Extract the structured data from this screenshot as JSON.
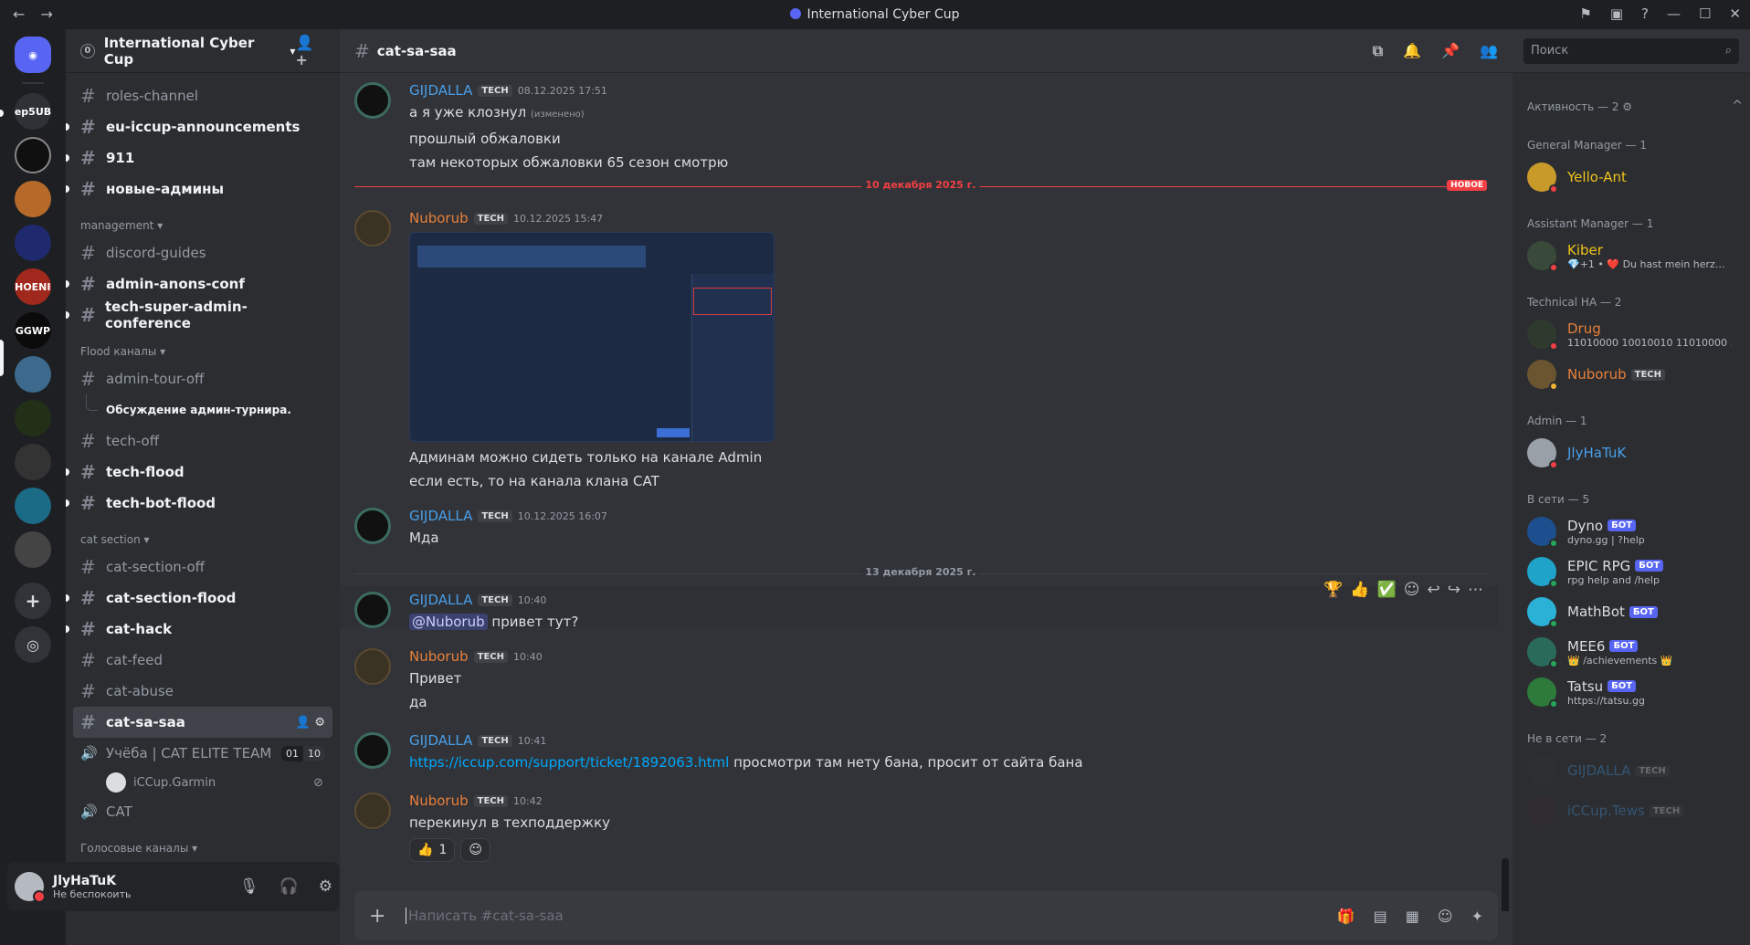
{
  "titlebar": {
    "back": "←",
    "forward": "→",
    "title": "International Cyber Cup"
  },
  "guilds": [
    "ep5UB",
    "",
    "",
    "",
    "",
    "PHOENIX",
    "GGWP",
    "",
    "",
    "",
    "",
    "",
    ""
  ],
  "server": {
    "badge": "0",
    "name": "International Cyber Cup"
  },
  "channels": {
    "top": [
      {
        "name": "roles-channel",
        "unread": false
      },
      {
        "name": "eu-iccup-announcements",
        "unread": true
      },
      {
        "name": "911",
        "unread": true
      },
      {
        "name": "новые-админы",
        "unread": true
      }
    ],
    "management_label": "management",
    "management": [
      {
        "name": "discord-guides",
        "unread": false
      },
      {
        "name": "admin-anons-conf",
        "unread": true
      },
      {
        "name": "tech-super-admin-conference",
        "unread": true
      }
    ],
    "flood_label": "Flood каналы",
    "flood": [
      {
        "name": "admin-tour-off",
        "unread": false
      }
    ],
    "thread": "Обсуждение админ-турнира.",
    "flood2": [
      {
        "name": "tech-off",
        "unread": false
      },
      {
        "name": "tech-flood",
        "unread": true
      },
      {
        "name": "tech-bot-flood",
        "unread": true
      }
    ],
    "cat_label": "cat section",
    "cat": [
      {
        "name": "cat-section-off",
        "unread": false
      },
      {
        "name": "cat-section-flood",
        "unread": true
      },
      {
        "name": "cat-hack",
        "unread": true
      },
      {
        "name": "cat-feed",
        "unread": false
      },
      {
        "name": "cat-abuse",
        "unread": false
      }
    ],
    "active": "cat-sa-saa",
    "voice1": {
      "name": "Учёба | CAT ELITE TEAM",
      "count_a": "01",
      "count_b": "10"
    },
    "voice_user": "iCCup.Garmin",
    "voice2": {
      "name": "CAT"
    },
    "voice_label": "Голосовые каналы"
  },
  "user": {
    "name": "JlyHaTuK",
    "status": "Не беспокоить"
  },
  "header": {
    "channel": "cat-sa-saa"
  },
  "messages": {
    "m1": {
      "author": "GIJDALLA",
      "tag": "TECH",
      "time": "08.12.2025 17:51",
      "lines": [
        "а я уже клознул",
        "прошлый обжаловки",
        "там некоторых обжаловки 65 сезон смотрю"
      ],
      "edited": "(изменено)"
    },
    "divider1": {
      "label": "10 декабря 2025 г.",
      "new": "НОВОЕ"
    },
    "m2": {
      "author": "Nuborub",
      "tag": "TECH",
      "time": "10.12.2025 15:47",
      "lines": [
        "Админам можно сидеть только на канале Admin",
        "если есть, то на канала клана CAT"
      ]
    },
    "m3": {
      "author": "GIJDALLA",
      "tag": "TECH",
      "time": "10.12.2025 16:07",
      "lines": [
        "Мда"
      ]
    },
    "divider2": {
      "label": "13 декабря 2025 г."
    },
    "m4": {
      "author": "GIJDALLA",
      "tag": "TECH",
      "time": "10:40",
      "mention": "@Nuborub",
      "text": "привет тут?"
    },
    "m5": {
      "author": "Nuborub",
      "tag": "TECH",
      "time": "10:40",
      "lines": [
        "Привет",
        "да"
      ]
    },
    "m6": {
      "author": "GIJDALLA",
      "tag": "TECH",
      "time": "10:41",
      "link": "https://iccup.com/support/ticket/1892063.html",
      "text": "просмотри там нету бана, просит от сайта бана"
    },
    "m7": {
      "author": "Nuborub",
      "tag": "TECH",
      "time": "10:42",
      "lines": [
        "перекинул в техподдержку"
      ],
      "reaction": {
        "emoji": "👍",
        "count": "1"
      }
    }
  },
  "composer": {
    "placeholder": "Написать #cat-sa-saa"
  },
  "search": {
    "placeholder": "Поиск"
  },
  "members": {
    "activity": "Активность — 2 ⚙",
    "groups": [
      {
        "label": "General Manager — 1",
        "items": [
          {
            "name": "Yello-Ant",
            "color": "#f0c31a",
            "status": "#f23f43"
          }
        ]
      },
      {
        "label": "Assistant Manager — 1",
        "items": [
          {
            "name": "Kiber",
            "color": "#f0c31a",
            "sub": "💎+1 • ❤️ Du hast mein herz...",
            "status": "#f23f43"
          }
        ]
      },
      {
        "label": "Technical HA — 2",
        "items": [
          {
            "name": "Drug",
            "color": "#e8803a",
            "sub": "11010000 10010010 11010000 ...",
            "status": "#f23f43"
          },
          {
            "name": "Nuborub",
            "color": "#e8803a",
            "tag": "TECH",
            "status": "#f0b232"
          }
        ]
      },
      {
        "label": "Admin — 1",
        "items": [
          {
            "name": "JlyHaTuK",
            "color": "#4a9fe8",
            "status": "#f23f43"
          }
        ]
      },
      {
        "label": "В сети — 5",
        "items": [
          {
            "name": "Dyno",
            "color": "#dbdee1",
            "bot": "БОТ",
            "sub": "dyno.gg | ?help",
            "status": "#23a55a"
          },
          {
            "name": "EPIC RPG",
            "color": "#dbdee1",
            "bot": "БОТ",
            "sub": "rpg help and /help",
            "status": "#23a55a"
          },
          {
            "name": "MathBot",
            "color": "#dbdee1",
            "bot": "БОТ",
            "status": "#23a55a"
          },
          {
            "name": "MEE6",
            "color": "#dbdee1",
            "bot": "БОТ",
            "sub": "👑 /achievements 👑",
            "status": "#23a55a"
          },
          {
            "name": "Tatsu",
            "color": "#dbdee1",
            "bot": "БОТ",
            "sub": "https://tatsu.gg",
            "status": "#23a55a"
          }
        ]
      },
      {
        "label": "Не в сети — 2",
        "items": [
          {
            "name": "GIJDALLA",
            "color": "#4a9fe8",
            "tag": "TECH",
            "offline": true
          },
          {
            "name": "iCCup.Tews",
            "color": "#4a9fe8",
            "tag": "TECH",
            "offline": true
          }
        ]
      }
    ]
  }
}
